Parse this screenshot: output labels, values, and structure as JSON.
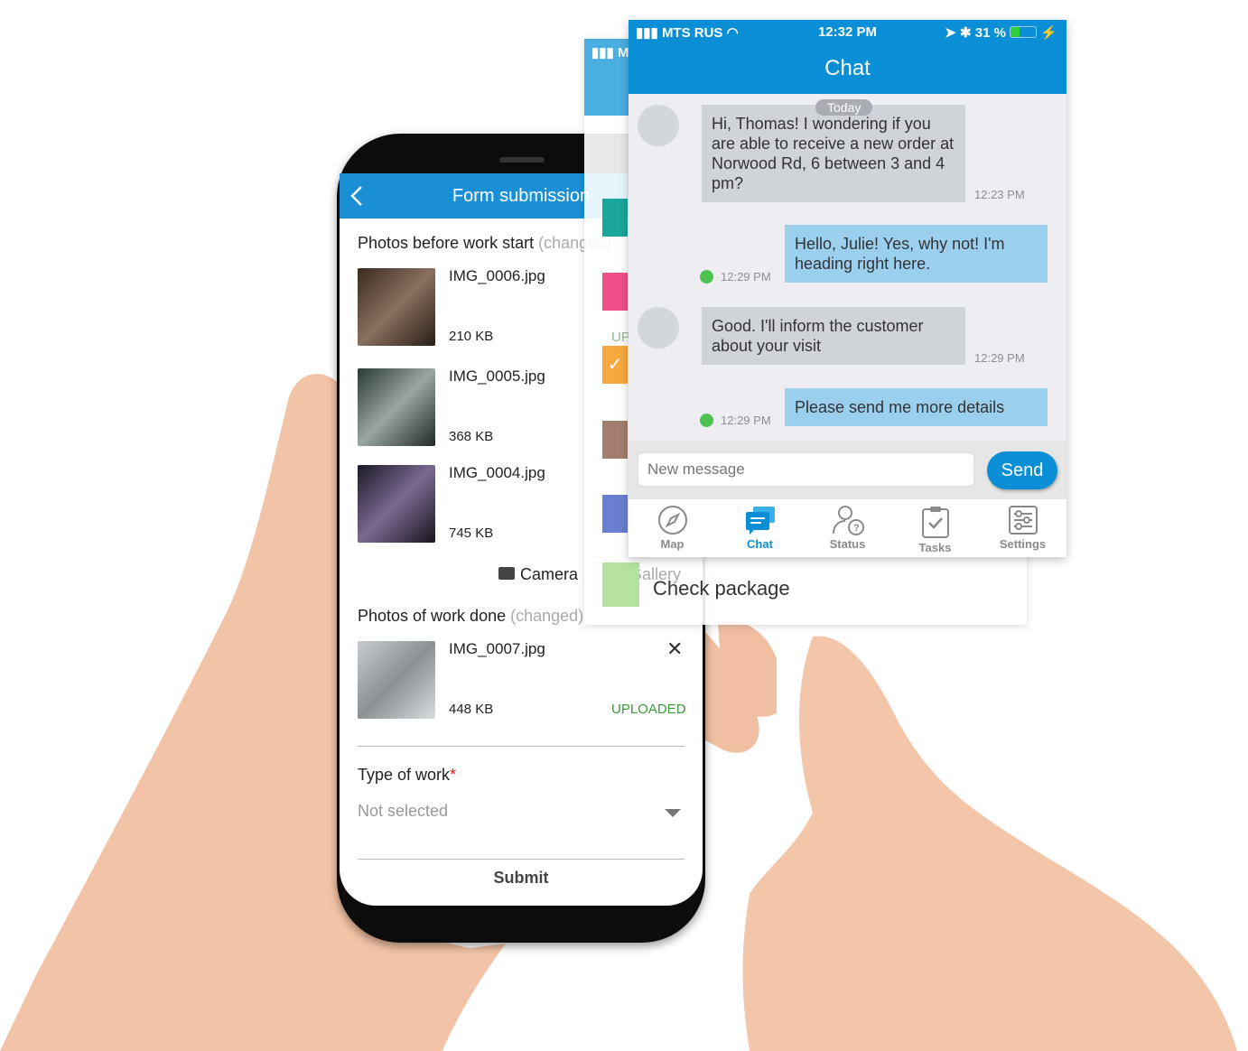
{
  "form": {
    "title": "Form submission",
    "section1": {
      "label": "Photos before work start",
      "note": "(changed)"
    },
    "photos_before": [
      {
        "name": "IMG_0006.jpg",
        "size": "210 KB"
      },
      {
        "name": "IMG_0005.jpg",
        "size": "368 KB"
      },
      {
        "name": "IMG_0004.jpg",
        "size": "745 KB"
      }
    ],
    "camera_label": "Camera",
    "gallery_label": "Gallery",
    "section2": {
      "label": "Photos of work done",
      "note": "(changed)"
    },
    "photos_done": [
      {
        "name": "IMG_0007.jpg",
        "size": "448 KB",
        "status": "UPLOADED"
      }
    ],
    "type_of_work": {
      "label": "Type of work",
      "required": "*",
      "value": "Not selected"
    },
    "submit_label": "Submit"
  },
  "tasks_card": {
    "status_partial": "M",
    "uploaded_partial": "UP",
    "last_task": "Check package",
    "colors": [
      "#1aa69a",
      "#f0508a",
      "#f7a940",
      "#a37e6e",
      "#6b7fd0",
      "#b4e0a0"
    ]
  },
  "chat": {
    "status_bar": {
      "carrier": "MTS RUS",
      "time": "12:32 PM",
      "battery": "31 %"
    },
    "title": "Chat",
    "date_badge": "Today",
    "messages": [
      {
        "dir": "in",
        "text": "Hi, Thomas! I wondering if you are able to receive a new order at Norwood Rd, 6 between 3 and 4 pm?",
        "time": "12:23 PM"
      },
      {
        "dir": "out",
        "text": "Hello, Julie! Yes, why not! I'm heading right here.",
        "time": "12:29 PM"
      },
      {
        "dir": "in",
        "text": "Good. I'll inform the customer about your visit",
        "time": "12:29 PM"
      },
      {
        "dir": "out",
        "text": "Please send me more details",
        "time": "12:29 PM"
      }
    ],
    "input_placeholder": "New message",
    "send_label": "Send",
    "tabs": [
      {
        "label": "Map",
        "icon": "compass-icon"
      },
      {
        "label": "Chat",
        "icon": "chat-icon",
        "active": true
      },
      {
        "label": "Status",
        "icon": "user-status-icon"
      },
      {
        "label": "Tasks",
        "icon": "clipboard-check-icon"
      },
      {
        "label": "Settings",
        "icon": "sliders-icon"
      }
    ],
    "accent": "#0a8fd6"
  }
}
